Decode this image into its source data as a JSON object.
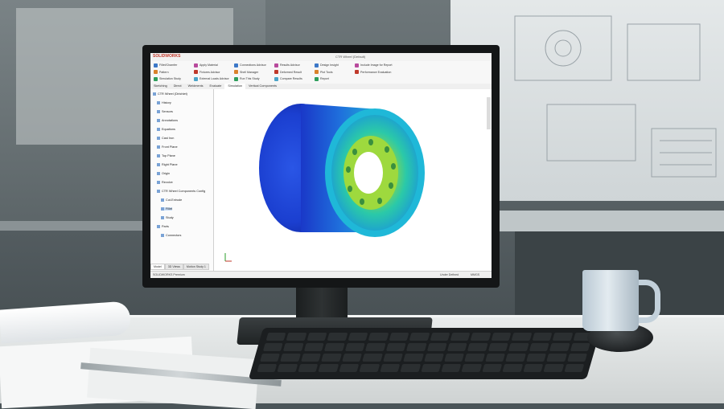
{
  "app": {
    "logo": "SOLIDWORKS",
    "document_title": "CTR Wheel (Default)"
  },
  "ribbon": {
    "groups": [
      {
        "label": "Fillet/Chamfer"
      },
      {
        "label": "Pattern"
      },
      {
        "label": "Simulation Study"
      },
      {
        "label": "Apply Material"
      },
      {
        "label": "Fixtures Advisor"
      },
      {
        "label": "External Loads Advisor"
      },
      {
        "label": "Connections Advisor"
      },
      {
        "label": "Shell Manager"
      },
      {
        "label": "Run This Study"
      },
      {
        "label": "Results Advisor"
      },
      {
        "label": "Deformed Result"
      },
      {
        "label": "Compare Results"
      },
      {
        "label": "Design Insight"
      },
      {
        "label": "Plot Tools"
      },
      {
        "label": "Report"
      },
      {
        "label": "Include Image for Report"
      },
      {
        "label": "Performance Evaluation"
      }
    ]
  },
  "tabs": [
    "Sketching",
    "Direct",
    "Weldments",
    "Evaluate",
    "Simulation",
    "Vertical Components"
  ],
  "tree": {
    "items": [
      {
        "label": "CTR Wheel (Dirichlet)",
        "indent": 0
      },
      {
        "label": "History",
        "indent": 1
      },
      {
        "label": "Sensors",
        "indent": 1
      },
      {
        "label": "Annotations",
        "indent": 1
      },
      {
        "label": "Equations",
        "indent": 1
      },
      {
        "label": "Cast Iron",
        "indent": 1
      },
      {
        "label": "Front Plane",
        "indent": 1
      },
      {
        "label": "Top Plane",
        "indent": 1
      },
      {
        "label": "Right Plane",
        "indent": 1
      },
      {
        "label": "Origin",
        "indent": 1
      },
      {
        "label": "Revolve",
        "indent": 1
      },
      {
        "label": "CTR Wheel Components Config",
        "indent": 1
      },
      {
        "label": "Cut-Extrude",
        "indent": 2
      },
      {
        "label": "Fillet",
        "indent": 2
      },
      {
        "label": "Study",
        "indent": 2
      },
      {
        "label": "Parts",
        "indent": 1
      },
      {
        "label": "Connectors",
        "indent": 2
      }
    ],
    "selected_index": 13
  },
  "bottom_tabs": [
    "Model",
    "3D Views",
    "Motion Study 1"
  ],
  "status": {
    "left": "SOLIDWORKS Premium",
    "right_1": "Under Defined",
    "right_2": "MMGS"
  },
  "colors": {
    "rim_blue": "#1e3fd0",
    "rim_cyan": "#1fb8d8",
    "rim_green": "#7fd13b",
    "rim_yellow": "#e8e23a",
    "brand_red": "#c0392b"
  },
  "icons": [
    "monitor-icon",
    "keyboard-icon",
    "mouse-icon",
    "mug-icon"
  ]
}
